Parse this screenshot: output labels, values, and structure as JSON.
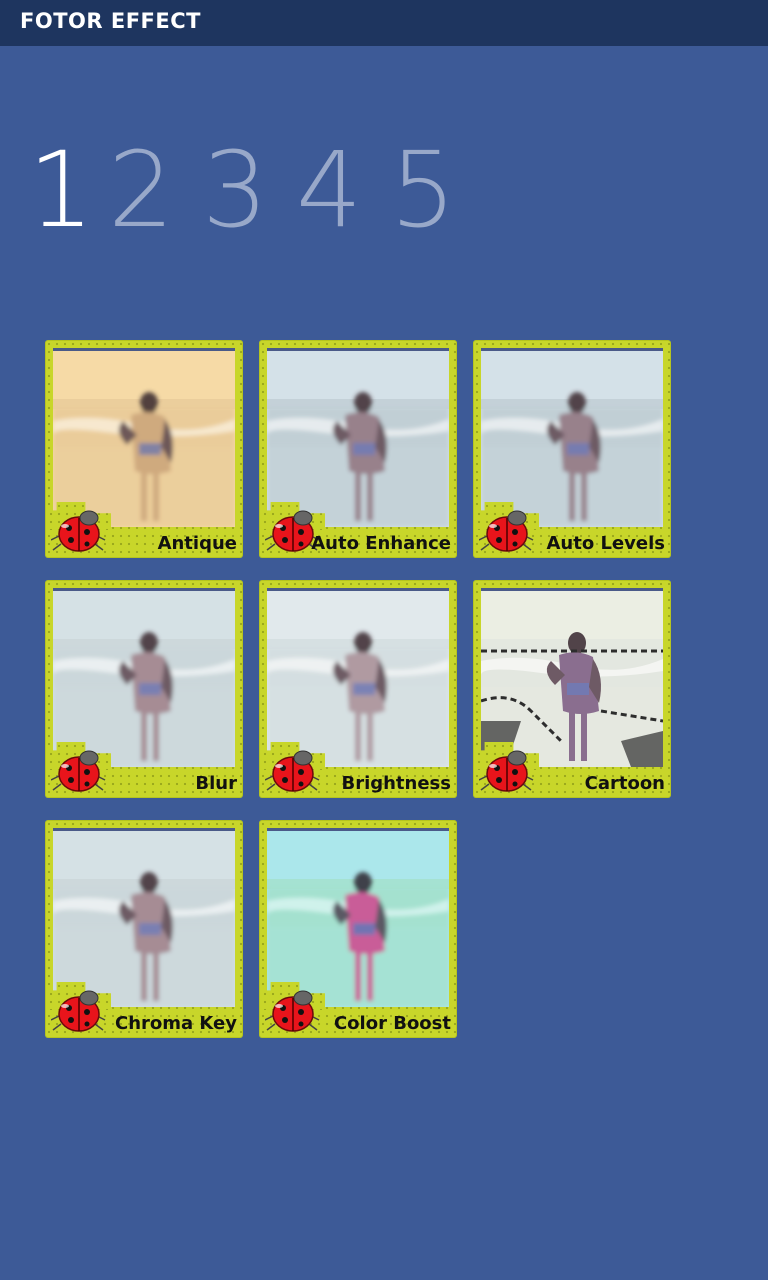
{
  "app": {
    "title": "FOTOR EFFECT"
  },
  "pager": {
    "pages": [
      "1",
      "2",
      "3",
      "4",
      "5"
    ],
    "active_index": 0
  },
  "effects": [
    {
      "label": "Antique",
      "tint": "#f5d9a8",
      "overlay": "#ffeaa0",
      "skin": "#c9a27a",
      "water": "#e8c99a"
    },
    {
      "label": "Auto Enhance",
      "tint": "#cfdde5",
      "overlay": "#ffffff",
      "skin": "#8a6f7c",
      "water": "#b9c9d0"
    },
    {
      "label": "Auto Levels",
      "tint": "#cfdde5",
      "overlay": "#ffffff",
      "skin": "#8a6f7c",
      "water": "#b9c9d0"
    },
    {
      "label": "Blur",
      "tint": "#d0dde2",
      "overlay": "#ffffff",
      "skin": "#9a7d86",
      "water": "#c4d2d6"
    },
    {
      "label": "Brightness",
      "tint": "#dde6ea",
      "overlay": "#ffffff",
      "skin": "#a58d95",
      "water": "#cfdadd"
    },
    {
      "label": "Cartoon",
      "tint": "#e9ece0",
      "overlay": "#ffffff",
      "skin": "#7a5a80",
      "water": "#e0e4dc"
    },
    {
      "label": "Chroma Key",
      "tint": "#d0dde2",
      "overlay": "#ffffff",
      "skin": "#9a7d86",
      "water": "#c4d2d6"
    },
    {
      "label": "Color Boost",
      "tint": "#b6e6e9",
      "overlay": "#5ff0ff",
      "skin": "#d84a8a",
      "water": "#aee0c9"
    }
  ]
}
